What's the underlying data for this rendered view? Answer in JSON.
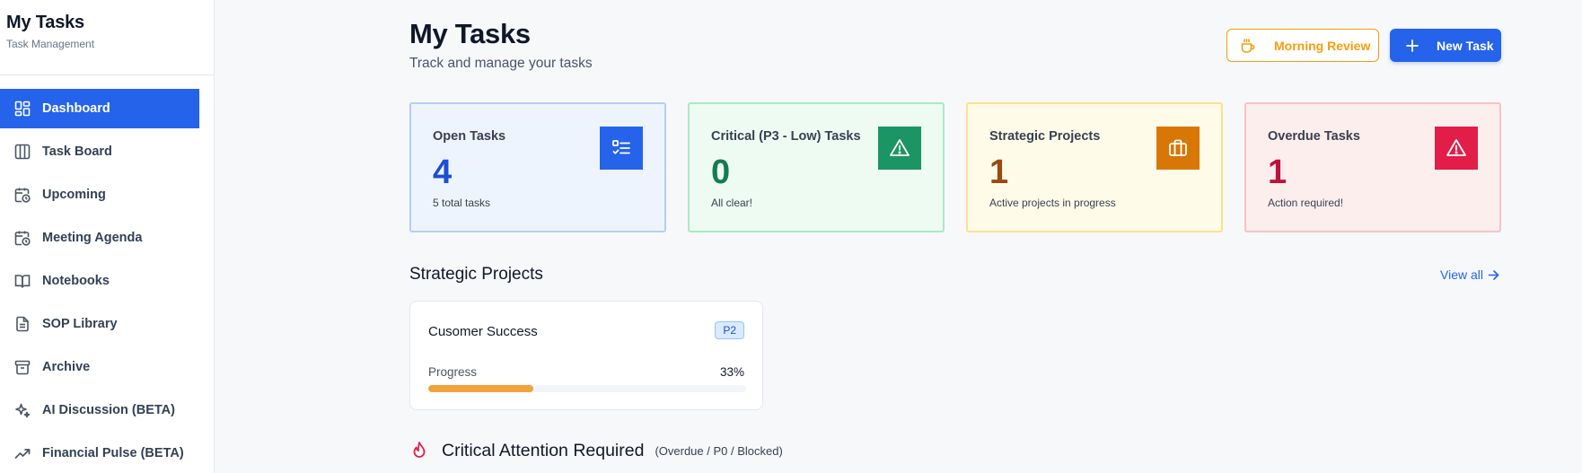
{
  "brand": {
    "title": "My Tasks",
    "subtitle": "Task Management"
  },
  "sidebar": {
    "items": [
      {
        "label": "Dashboard",
        "icon": "dashboard-icon",
        "active": true
      },
      {
        "label": "Task Board",
        "icon": "columns-icon"
      },
      {
        "label": "Upcoming",
        "icon": "calendar-clock-icon"
      },
      {
        "label": "Meeting Agenda",
        "icon": "calendar-clock-icon"
      },
      {
        "label": "Notebooks",
        "icon": "book-open-icon"
      },
      {
        "label": "SOP Library",
        "icon": "document-icon"
      },
      {
        "label": "Archive",
        "icon": "archive-icon"
      },
      {
        "label": "AI Discussion (BETA)",
        "icon": "sparkles-icon"
      },
      {
        "label": "Financial Pulse (BETA)",
        "icon": "trending-up-icon"
      }
    ]
  },
  "header": {
    "title": "My Tasks",
    "subtitle": "Track and manage your tasks",
    "morning_review_label": "Morning Review",
    "new_task_label": "New Task"
  },
  "stats": [
    {
      "label": "Open Tasks",
      "value": "4",
      "note": "5 total tasks",
      "icon": "checklist-icon",
      "color": "#2563eb"
    },
    {
      "label": "Critical (P3 - Low) Tasks",
      "value": "0",
      "note": "All clear!",
      "icon": "warning-icon",
      "color": "#1b9563"
    },
    {
      "label": "Strategic Projects",
      "value": "1",
      "note": "Active projects in progress",
      "icon": "briefcase-icon",
      "color": "#d97706"
    },
    {
      "label": "Overdue Tasks",
      "value": "1",
      "note": "Action required!",
      "icon": "warning-icon",
      "color": "#e11d48"
    }
  ],
  "strategic_projects": {
    "title": "Strategic Projects",
    "view_all_label": "View all",
    "projects": [
      {
        "name": "Cusomer Success",
        "priority": "P2",
        "progress_label": "Progress",
        "progress_text": "33%",
        "progress": 0.33
      }
    ]
  },
  "critical": {
    "title": "Critical Attention Required",
    "subtitle": "(Overdue / P0 / Blocked)"
  },
  "colors": {
    "accent": "#2563eb",
    "warning": "#f59e0b",
    "danger": "#e11d48",
    "success": "#1b9563"
  }
}
